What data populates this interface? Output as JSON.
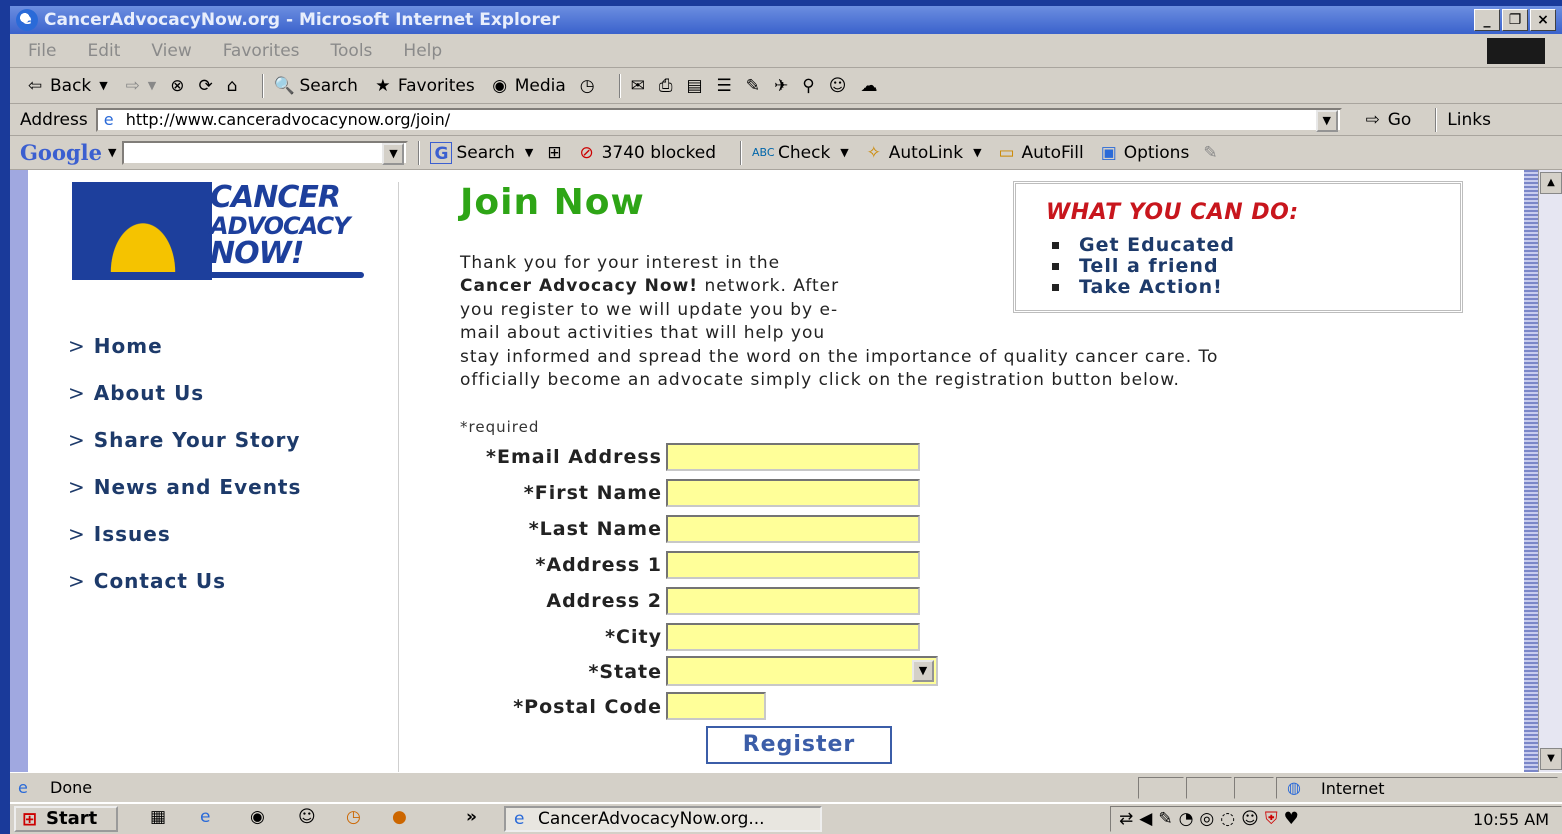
{
  "window": {
    "title": "CancerAdvocacyNow.org - Microsoft Internet Explorer",
    "minimize": "_",
    "restore": "❐",
    "close": "×"
  },
  "menu": [
    "File",
    "Edit",
    "View",
    "Favorites",
    "Tools",
    "Help"
  ],
  "toolbar": {
    "back": "Back",
    "search": "Search",
    "favorites": "Favorites",
    "media": "Media"
  },
  "address": {
    "label": "Address",
    "url": "http://www.canceradvocacynow.org/join/",
    "go": "Go",
    "links": "Links"
  },
  "google_bar": {
    "brand": "Google",
    "search_label": "Search",
    "blocked": "3740 blocked",
    "check": "Check",
    "autolink": "AutoLink",
    "autofill": "AutoFill",
    "options": "Options"
  },
  "logo": {
    "line1": "CANCER",
    "line2": "ADVOCACY",
    "line3": "NOW!"
  },
  "nav": {
    "items": [
      {
        "label": "Home"
      },
      {
        "label": "About Us"
      },
      {
        "label": "Share Your Story"
      },
      {
        "label": "News and Events"
      },
      {
        "label": "Issues"
      },
      {
        "label": "Contact Us"
      }
    ]
  },
  "main": {
    "title": "Join Now",
    "intro_line1": "Thank you for your interest in the",
    "intro_org": "Cancer Advocacy Now!",
    "intro_line2_rest": " network. After",
    "intro_line3": "you register to we will update you by e-",
    "intro_line4": "mail about activities that will help you",
    "intro_line5": "stay informed and spread the word on the importance of quality cancer care. To",
    "intro_line6": "officially become an advocate simply click on the registration button below."
  },
  "what_you_can_do": {
    "title": "WHAT YOU CAN DO:",
    "items": [
      "Get Educated",
      "Tell a friend",
      "Take Action!"
    ]
  },
  "form": {
    "required_note": "*required",
    "fields": [
      {
        "label": "*Email Address",
        "value": ""
      },
      {
        "label": "*First Name",
        "value": ""
      },
      {
        "label": "*Last Name",
        "value": ""
      },
      {
        "label": "*Address 1",
        "value": ""
      },
      {
        "label": "Address 2",
        "value": ""
      },
      {
        "label": "*City",
        "value": ""
      },
      {
        "label": "*State",
        "value": ""
      },
      {
        "label": "*Postal Code",
        "value": ""
      }
    ],
    "submit": "Register"
  },
  "status": {
    "text": "Done",
    "zone": "Internet"
  },
  "taskbar": {
    "start": "Start",
    "task": "CancerAdvocacyNow.org...",
    "clock": "10:55 AM"
  },
  "colors": {
    "title_green": "#2ea516",
    "what_red": "#c8161d",
    "nav_navy": "#1d3a6a",
    "input_yellow": "#ffff99"
  }
}
